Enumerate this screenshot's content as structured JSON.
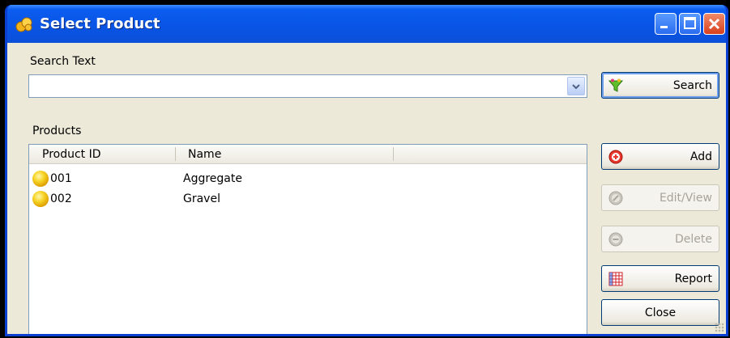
{
  "window": {
    "title": "Select Product"
  },
  "search": {
    "label": "Search Text",
    "value": "",
    "button_label": "Search"
  },
  "products": {
    "label": "Products",
    "columns": [
      "Product ID",
      "Name"
    ],
    "rows": [
      {
        "id": "001",
        "name": "Aggregate"
      },
      {
        "id": "002",
        "name": "Gravel"
      }
    ]
  },
  "buttons": {
    "add": "Add",
    "edit_view": "Edit/View",
    "delete": "Delete",
    "report": "Report",
    "close": "Close"
  },
  "icons": {
    "app": "product-coins-icon",
    "search": "funnel-icon",
    "add": "add-circle-icon",
    "edit": "edit-circle-icon",
    "delete": "delete-circle-icon",
    "report": "grid-report-icon",
    "row": "product-bullet-icon"
  }
}
